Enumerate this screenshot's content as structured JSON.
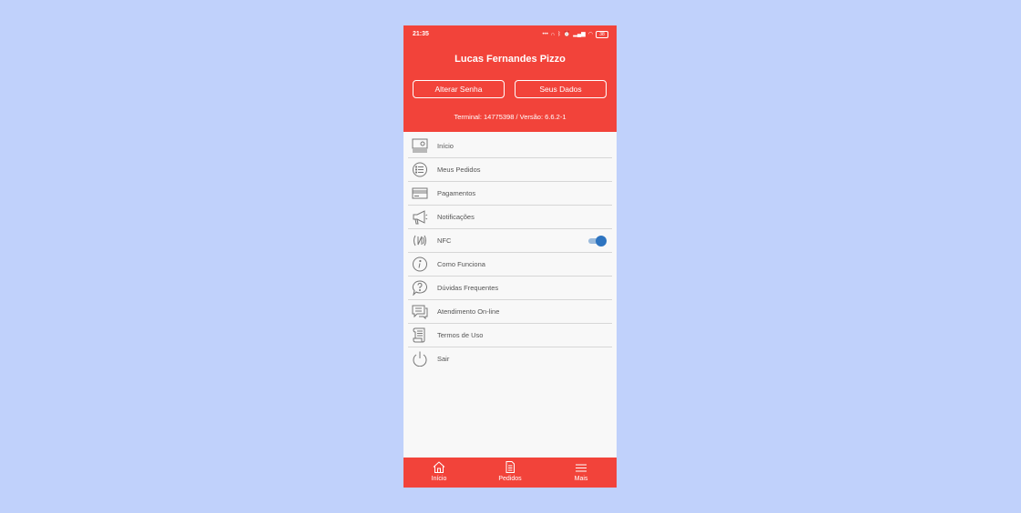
{
  "status_bar": {
    "time": "21:35",
    "battery": "38"
  },
  "header": {
    "user_name": "Lucas Fernandes Pizzo",
    "change_password_label": "Alterar Senha",
    "your_data_label": "Seus Dados",
    "version_text": "Terminal: 14775398 / Versão:  6.6.2-1"
  },
  "menu": {
    "items": [
      {
        "label": "Início",
        "icon": "monitor-icon"
      },
      {
        "label": "Meus Pedidos",
        "icon": "list-circle-icon"
      },
      {
        "label": "Pagamentos",
        "icon": "card-icon"
      },
      {
        "label": "Notificações",
        "icon": "megaphone-icon"
      },
      {
        "label": "NFC",
        "icon": "nfc-icon",
        "toggle_on": true
      },
      {
        "label": "Como Funciona",
        "icon": "info-icon"
      },
      {
        "label": "Dúvidas Frequentes",
        "icon": "question-bubble-icon"
      },
      {
        "label": "Atendimento On-line",
        "icon": "chat-icon"
      },
      {
        "label": "Termos de Uso",
        "icon": "scroll-icon"
      },
      {
        "label": "Sair",
        "icon": "power-icon"
      }
    ]
  },
  "tabbar": {
    "tabs": [
      {
        "label": "Início",
        "icon": "home-icon"
      },
      {
        "label": "Pedidos",
        "icon": "document-icon"
      },
      {
        "label": "Mais",
        "icon": "menu-icon"
      }
    ]
  },
  "colors": {
    "brand_red": "#f2433a",
    "background": "#c0d1fb",
    "toggle_blue": "#2e74c0"
  }
}
